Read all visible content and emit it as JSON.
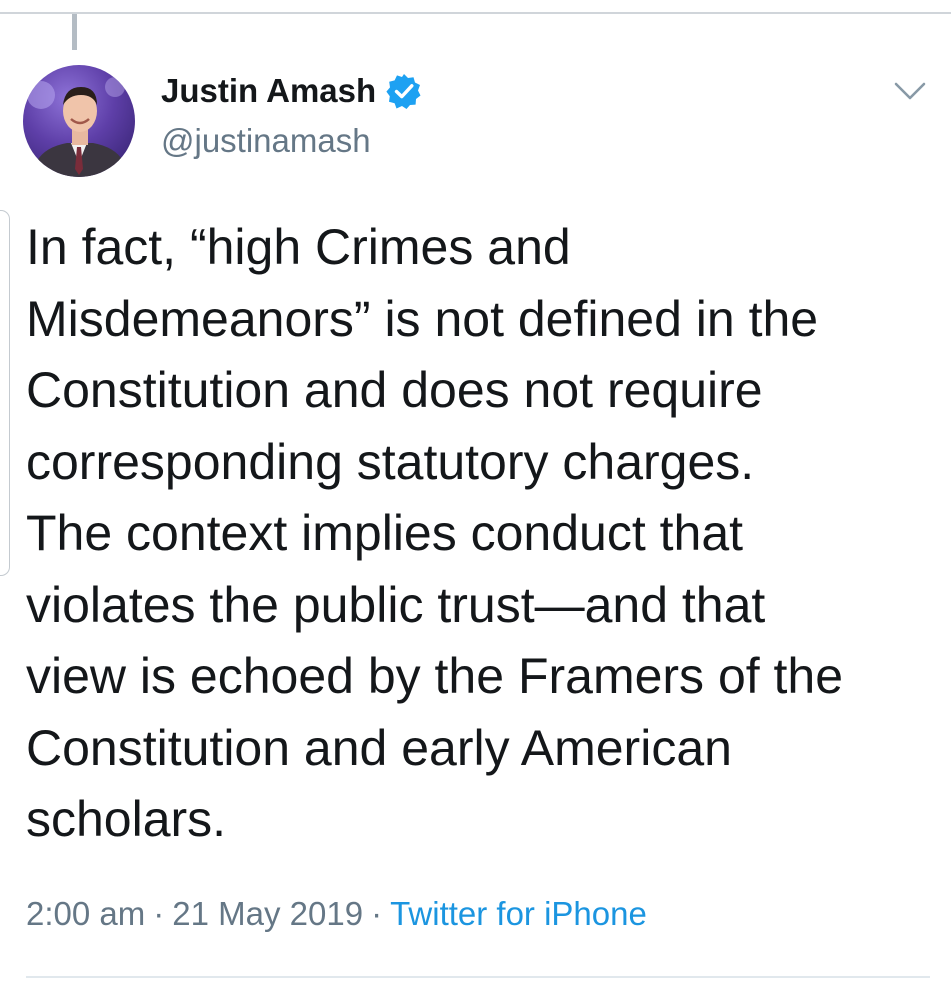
{
  "author": {
    "name": "Justin Amash",
    "handle": "@justinamash",
    "verified": true,
    "avatar_icon": "profile-photo",
    "verified_icon": "verified-badge-icon"
  },
  "tweet": {
    "text": "In fact, “high Crimes and\nMisdemeanors” is not defined in the\nConstitution and does not require\ncorresponding statutory charges.\nThe context implies conduct that\nviolates the public trust—and that\nview is echoed by the Framers of the\nConstitution and early American\nscholars.",
    "time": "2:00 am",
    "date": "21 May 2019",
    "source": "Twitter for iPhone",
    "separator": "·"
  },
  "icons": {
    "menu": "chevron-down-icon"
  },
  "colors": {
    "link": "#1b95e0",
    "verified": "#1da1f2",
    "secondary_text": "#657786",
    "primary_text": "#14171a"
  }
}
